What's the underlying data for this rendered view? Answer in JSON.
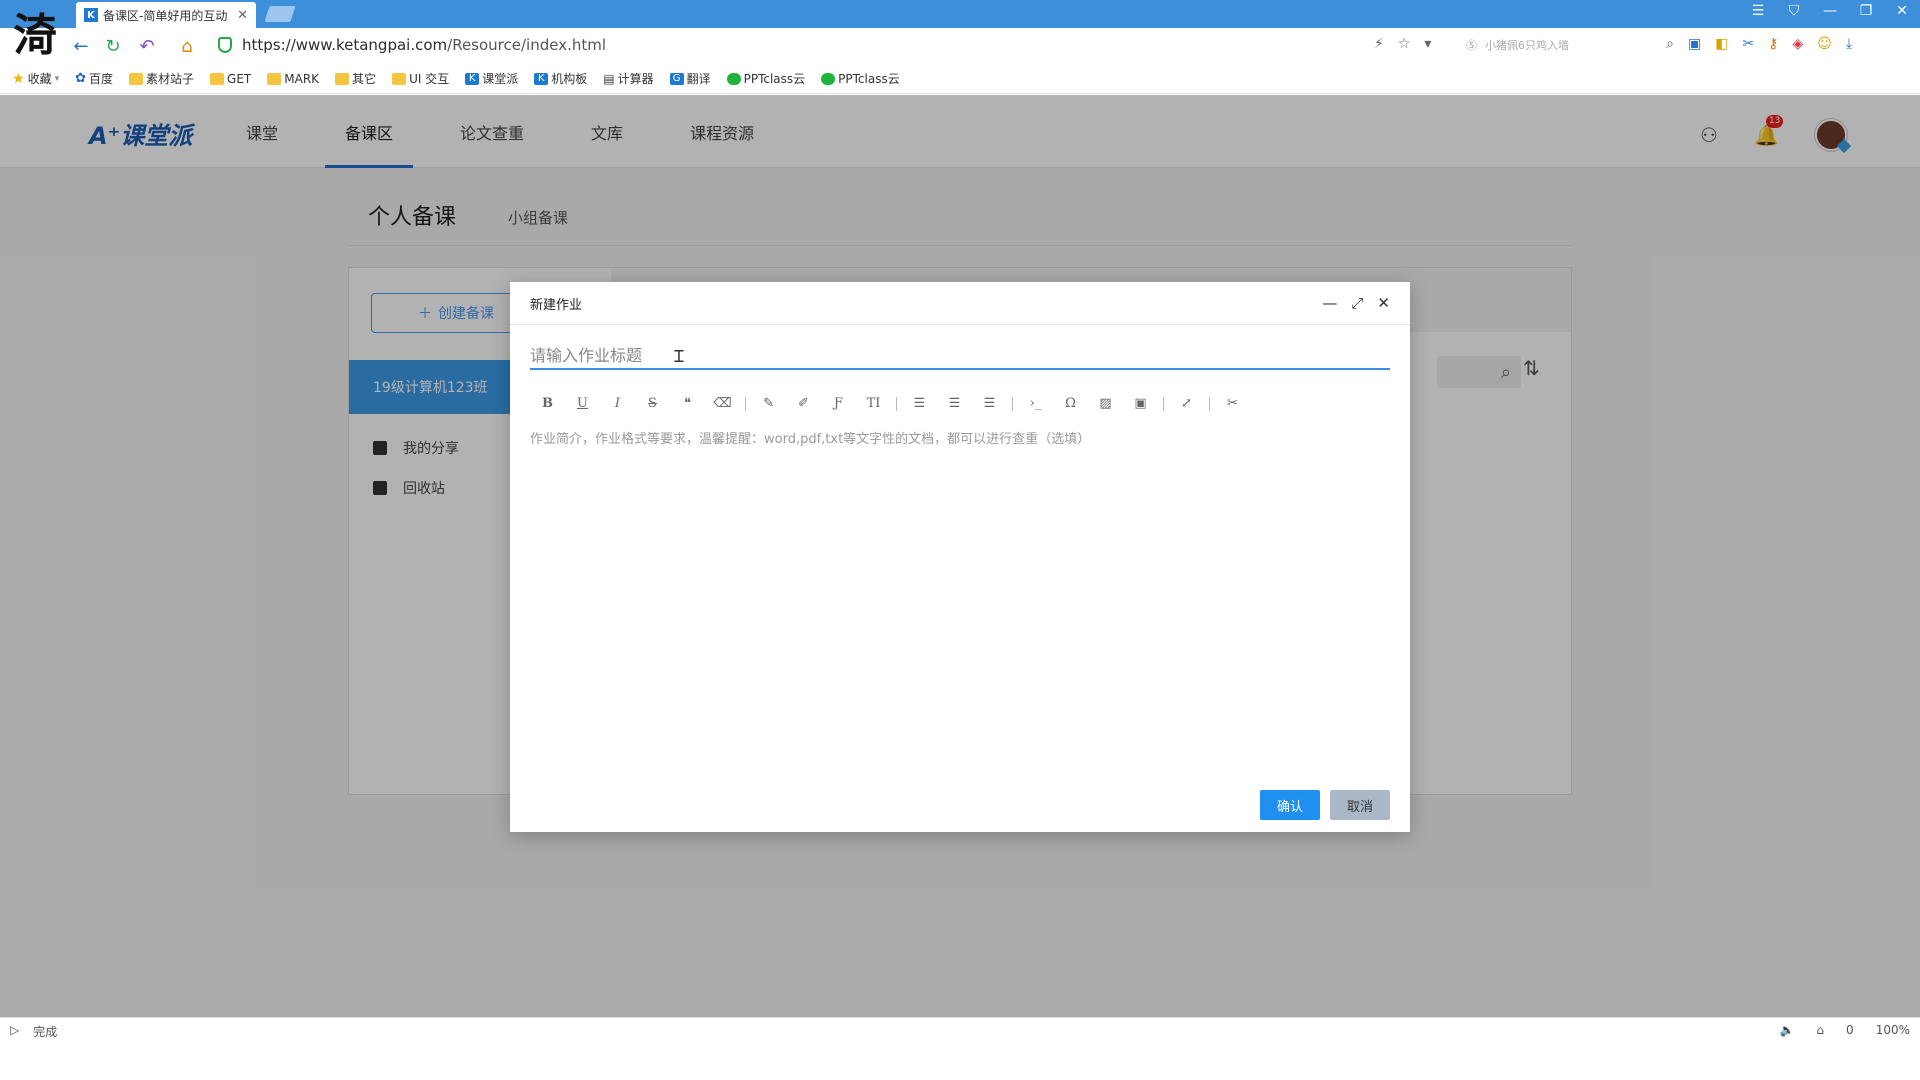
{
  "browser": {
    "logo_glyph": "渏",
    "tab": {
      "favicon": "K",
      "title": "备课区-简单好用的互动",
      "close": "✕"
    },
    "window_controls": [
      "☰",
      "⛉",
      "—",
      "❐",
      "✕"
    ],
    "url_host": "https://www.ketangpai.com",
    "url_path": "/Resource/index.html",
    "search_placeholder": "小猪佩6只鸡入墙",
    "bookmarks": [
      {
        "label": "收藏",
        "icon": "star-icon"
      },
      {
        "label": "百度",
        "icon": "paw-icon"
      },
      {
        "label": "素材站子",
        "icon": "folder-icon"
      },
      {
        "label": "GET",
        "icon": "folder-icon"
      },
      {
        "label": "MARK",
        "icon": "folder-icon"
      },
      {
        "label": "其它",
        "icon": "folder-icon"
      },
      {
        "label": "UI 交互",
        "icon": "folder-icon"
      },
      {
        "label": "课堂派",
        "icon": "k-icon"
      },
      {
        "label": "机构板",
        "icon": "k-icon"
      },
      {
        "label": "计算器",
        "icon": "calc-icon"
      },
      {
        "label": "翻译",
        "icon": "translate-icon"
      },
      {
        "label": "PPTclass云",
        "icon": "cloud-icon"
      },
      {
        "label": "PPTclass云",
        "icon": "cloud-icon"
      }
    ]
  },
  "app": {
    "logo": "A⁺课堂派",
    "nav": [
      "课堂",
      "备课区",
      "论文查重",
      "文库",
      "课程资源"
    ],
    "active_nav": "备课区",
    "notification_count": "13",
    "page_title": "个人备课",
    "sub_tab": "小组备课",
    "create_label": "创建备课",
    "class_item": "19级计算机123班",
    "side_links": [
      "我的分享",
      "回收站"
    ]
  },
  "modal": {
    "title": "新建作业",
    "title_placeholder": "请输入作业标题",
    "editor_placeholder": "作业简介，作业格式等要求，温馨提醒：word,pdf,txt等文字性的文档，都可以进行查重（选填）",
    "toolbar_icons": [
      "bold-icon",
      "underline-icon",
      "italic-icon",
      "strikethrough-icon",
      "quote-icon",
      "eraser-icon",
      "pen-icon",
      "brush-icon",
      "font-icon",
      "text-size-icon",
      "align-left-icon",
      "align-center-icon",
      "align-right-icon",
      "code-icon",
      "omega-icon",
      "image-icon",
      "video-icon",
      "fullscreen-icon",
      "unlink-icon"
    ],
    "confirm": "确认",
    "cancel": "取消"
  },
  "status": {
    "left": "完成",
    "right_items": [
      "🔈",
      "⌂",
      "0",
      "100%"
    ]
  },
  "colors": {
    "accent": "#1f8ff0",
    "brand": "#1b5db3",
    "chrome": "#3c8fd8"
  }
}
